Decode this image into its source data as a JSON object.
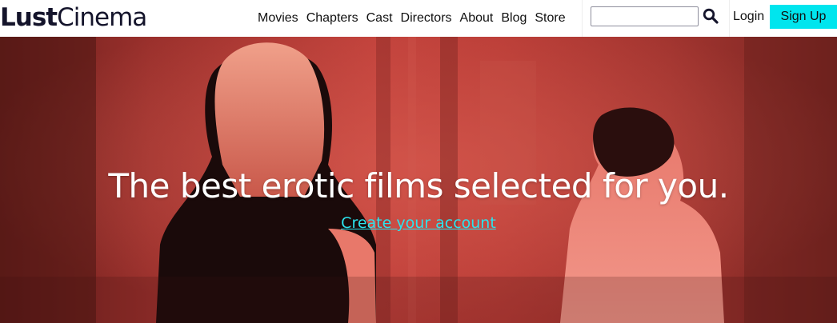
{
  "brand": {
    "logo_bold": "Lust",
    "logo_light": "Cinema"
  },
  "nav": {
    "items": [
      {
        "label": "Movies"
      },
      {
        "label": "Chapters"
      },
      {
        "label": "Cast"
      },
      {
        "label": "Directors"
      },
      {
        "label": "About"
      },
      {
        "label": "Blog"
      },
      {
        "label": "Store"
      }
    ]
  },
  "search": {
    "value": "",
    "placeholder": "",
    "icon": "search-icon"
  },
  "auth": {
    "login_label": "Login",
    "signup_label": "Sign Up"
  },
  "hero": {
    "title": "The best erotic films selected for you.",
    "cta_label": "Create your account"
  },
  "colors": {
    "brand_dark": "#14142b",
    "accent_cyan": "#00e5ee",
    "cta_link": "#2be4ee",
    "hero_tone": "#b83a36"
  }
}
